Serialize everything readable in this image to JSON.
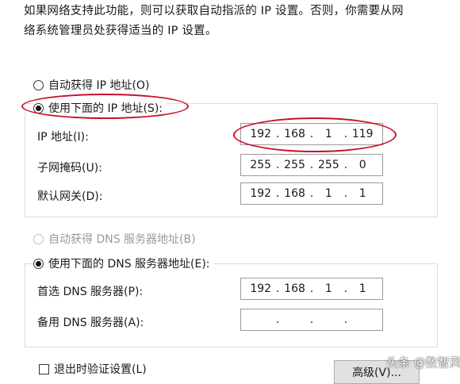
{
  "description": {
    "line1": "如果网络支持此功能，则可以获取自动指派的 IP 设置。否则，你需要从网",
    "line2": "络系统管理员处获得适当的 IP 设置。"
  },
  "ip_section": {
    "auto_option": "自动获得 IP 地址(O)",
    "manual_option": "使用下面的 IP 地址(S):",
    "selected": "manual",
    "fields": [
      {
        "label": "IP 地址(I):",
        "octets": [
          "192",
          "168",
          "1",
          "119"
        ]
      },
      {
        "label": "子网掩码(U):",
        "octets": [
          "255",
          "255",
          "255",
          "0"
        ]
      },
      {
        "label": "默认网关(D):",
        "octets": [
          "192",
          "168",
          "1",
          "1"
        ]
      }
    ]
  },
  "dns_section": {
    "auto_option": "自动获得 DNS 服务器地址(B)",
    "manual_option": "使用下面的 DNS 服务器地址(E):",
    "selected": "manual",
    "fields": [
      {
        "label": "首选 DNS 服务器(P):",
        "octets": [
          "192",
          "168",
          "1",
          "1"
        ]
      },
      {
        "label": "备用 DNS 服务器(A):",
        "octets": [
          "",
          "",
          "",
          ""
        ]
      }
    ]
  },
  "footer": {
    "validate_checkbox": "退出时验证设置(L)",
    "validate_checked": false,
    "advanced_button": "高级(V)..."
  },
  "watermark": "头条 @数智风",
  "colors": {
    "annotation": "#c8102e"
  }
}
